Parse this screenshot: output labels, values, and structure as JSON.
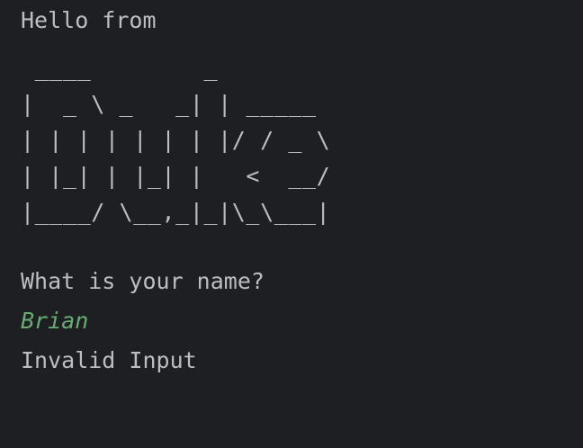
{
  "console": {
    "greeting": "Hello from",
    "ascii_logo": [
      " ____        _",
      "|  _ \\ _   _| | _____",
      "| | | | | | | |/ / _ \\",
      "| |_| | |_| |   <  __/",
      "|____/ \\__,_|_|\\_\\___|"
    ],
    "prompt": "What is your name?",
    "user_input": "Brian",
    "response": "Invalid Input"
  },
  "colors": {
    "background": "#1e1f22",
    "text": "#bcbec4",
    "user_input": "#6aab73"
  }
}
